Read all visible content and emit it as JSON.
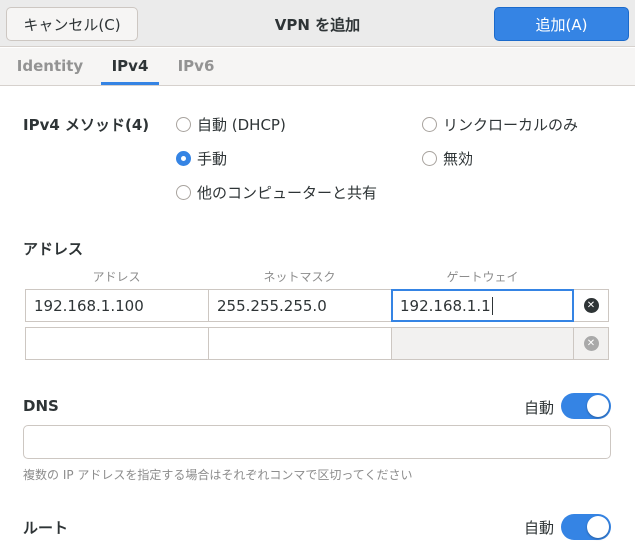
{
  "header": {
    "cancel_label": "キャンセル(C)",
    "title": "VPN を追加",
    "add_label": "追加(A)"
  },
  "tabs": [
    {
      "label": "Identity",
      "active": false
    },
    {
      "label": "IPv4",
      "active": true
    },
    {
      "label": "IPv6",
      "active": false
    }
  ],
  "method": {
    "label": "IPv4 メソッド(4)",
    "options": [
      {
        "label": "自動 (DHCP)",
        "checked": false
      },
      {
        "label": "手動",
        "checked": true
      },
      {
        "label": "他のコンピューターと共有",
        "checked": false
      },
      {
        "label": "リンクローカルのみ",
        "checked": false
      },
      {
        "label": "無効",
        "checked": false
      }
    ]
  },
  "addresses": {
    "label": "アドレス",
    "columns": [
      "アドレス",
      "ネットマスク",
      "ゲートウェイ"
    ],
    "rows": [
      {
        "address": "192.168.1.100",
        "netmask": "255.255.255.0",
        "gateway": "192.168.1.1"
      },
      {
        "address": "",
        "netmask": "",
        "gateway": ""
      }
    ]
  },
  "dns": {
    "label": "DNS",
    "auto_label": "自動",
    "auto_enabled": true,
    "value": "",
    "hint": "複数の IP アドレスを指定する場合はそれぞれコンマで区切ってください"
  },
  "routes": {
    "label": "ルート",
    "auto_label": "自動",
    "auto_enabled": true
  },
  "colors": {
    "accent": "#3584e4",
    "header_bg": "#ebebeb"
  }
}
